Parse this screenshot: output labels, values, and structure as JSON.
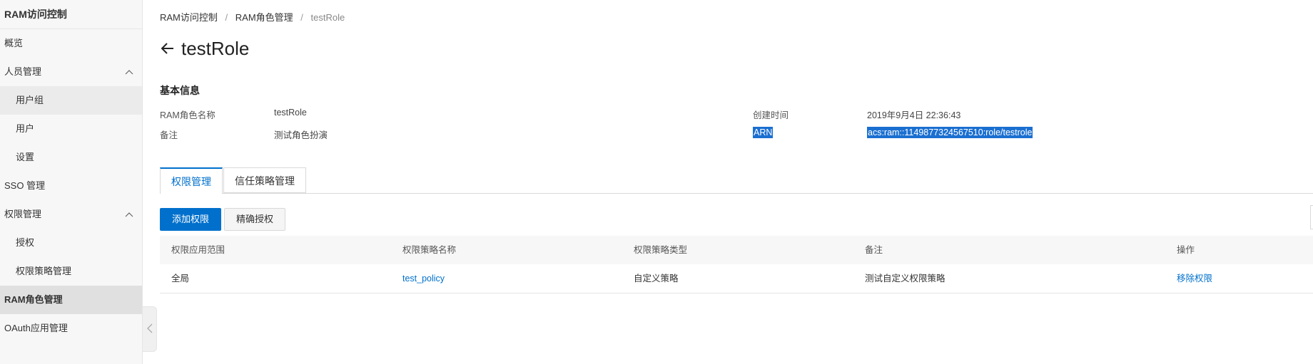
{
  "sidebar": {
    "title": "RAM访问控制",
    "items": [
      {
        "label": "概览"
      },
      {
        "label": "人员管理"
      },
      {
        "label": "用户组"
      },
      {
        "label": "用户"
      },
      {
        "label": "设置"
      },
      {
        "label": "SSO 管理"
      },
      {
        "label": "权限管理"
      },
      {
        "label": "授权"
      },
      {
        "label": "权限策略管理"
      },
      {
        "label": "RAM角色管理"
      },
      {
        "label": "OAuth应用管理"
      }
    ]
  },
  "breadcrumb": {
    "items": [
      "RAM访问控制",
      "RAM角色管理",
      "testRole"
    ],
    "separator": "/"
  },
  "page": {
    "title": "testRole",
    "section_title": "基本信息"
  },
  "info": {
    "role_name_label": "RAM角色名称",
    "role_name_value": "testRole",
    "remark_label": "备注",
    "remark_value": "测试角色扮演",
    "created_label": "创建时间",
    "created_value": "2019年9月4日 22:36:43",
    "arn_label": "ARN",
    "arn_value": "acs:ram::1149877324567510:role/testrole"
  },
  "tabs": [
    {
      "label": "权限管理"
    },
    {
      "label": "信任策略管理"
    }
  ],
  "buttons": {
    "add": "添加权限",
    "precise": "精确授权"
  },
  "table": {
    "headers": [
      "权限应用范围",
      "权限策略名称",
      "权限策略类型",
      "备注",
      "操作"
    ],
    "rows": [
      {
        "scope": "全局",
        "policy": "test_policy",
        "type": "自定义策略",
        "remark": "测试自定义权限策略",
        "action": "移除权限"
      }
    ]
  },
  "colors": {
    "accent": "#0070cc",
    "selection": "#1a6fd1"
  },
  "icons": {
    "back": "arrow-left-icon",
    "expand": "chevron-up-icon",
    "collapse": "chevron-left-icon"
  }
}
